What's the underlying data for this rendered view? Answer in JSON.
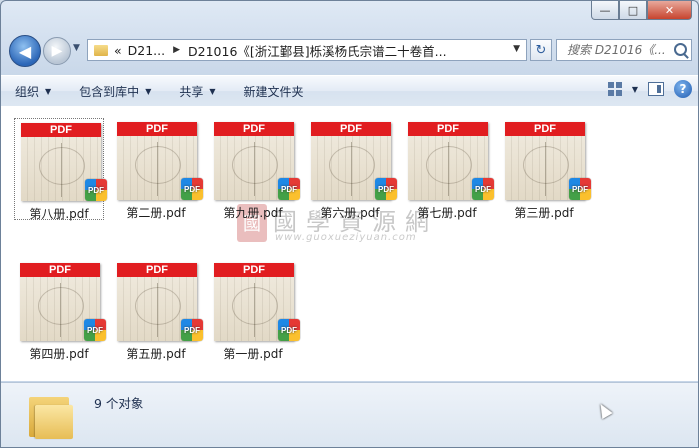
{
  "window": {
    "controls": {
      "minimize": "—",
      "maximize": "□",
      "close": "✕"
    }
  },
  "nav": {
    "back_glyph": "◀",
    "forward_glyph": "▶",
    "breadcrumb": {
      "overflow": "«",
      "crumbs": [
        "D21...",
        "D21016《[浙江鄞县]栎溪杨氏宗谱二十卷首..."
      ]
    },
    "search": {
      "placeholder": "搜索 D21016《..."
    },
    "refresh_glyph": "↻"
  },
  "toolbar": {
    "organize": "组织",
    "include_in_library": "包含到库中",
    "share": "共享",
    "new_folder": "新建文件夹",
    "help_glyph": "?"
  },
  "files": [
    {
      "name": "第八册.pdf",
      "selected": true
    },
    {
      "name": "第二册.pdf",
      "selected": false
    },
    {
      "name": "第九册.pdf",
      "selected": false
    },
    {
      "name": "第六册.pdf",
      "selected": false
    },
    {
      "name": "第七册.pdf",
      "selected": false
    },
    {
      "name": "第三册.pdf",
      "selected": false
    },
    {
      "name": "第四册.pdf",
      "selected": false
    },
    {
      "name": "第五册.pdf",
      "selected": false
    },
    {
      "name": "第一册.pdf",
      "selected": false
    }
  ],
  "thumb_band_label": "PDF",
  "badge_label": "PDF",
  "watermark": {
    "seal": "國",
    "title": "國學資源網",
    "url": "www.guoxueziyuan.com"
  },
  "status": {
    "count": "9 个对象"
  },
  "colors": {
    "pdf_band": "#e11d20",
    "content_bg": "#ffffff",
    "chrome": "#cfdbe8"
  }
}
